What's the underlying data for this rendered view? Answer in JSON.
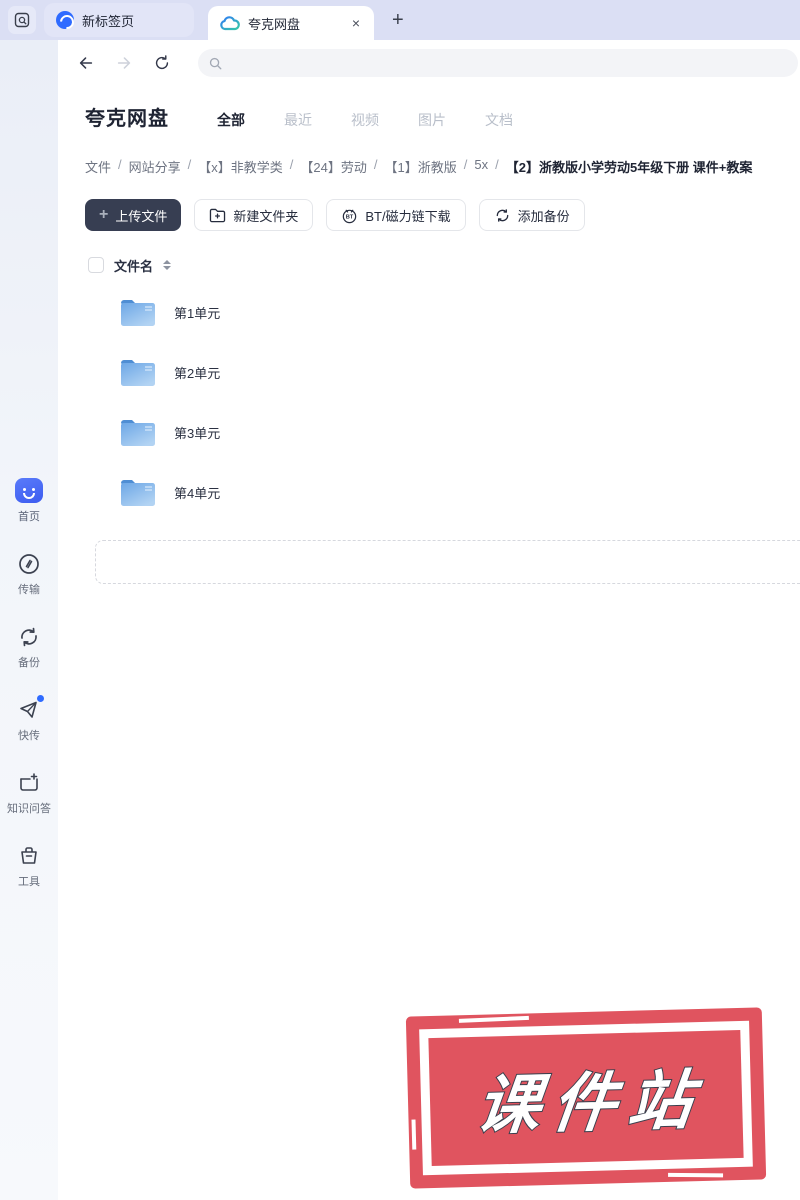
{
  "browser": {
    "tabs": [
      {
        "title": "新标签页",
        "active": false
      },
      {
        "title": "夸克网盘",
        "active": true
      }
    ],
    "close_glyph": "×",
    "new_tab_glyph": "+"
  },
  "nav": {
    "search_placeholder": ""
  },
  "header": {
    "app_title": "夸克网盘",
    "filter_tabs": [
      {
        "label": "全部",
        "active": true
      },
      {
        "label": "最近",
        "active": false
      },
      {
        "label": "视频",
        "active": false
      },
      {
        "label": "图片",
        "active": false
      },
      {
        "label": "文档",
        "active": false
      }
    ]
  },
  "breadcrumb": {
    "separator": "/",
    "items": [
      "文件",
      "网站分享",
      "【x】非教学类",
      "【24】劳动",
      "【1】浙教版",
      "5x",
      "【2】浙教版小学劳动5年级下册 课件+教案"
    ]
  },
  "toolbar": {
    "upload_label": "上传文件",
    "upload_plus": "+",
    "new_folder_label": "新建文件夹",
    "bt_download_label": "BT/磁力链下载",
    "bt_glyph": "BT",
    "add_backup_label": "添加备份"
  },
  "file_list": {
    "header_label": "文件名",
    "folders": [
      {
        "name": "第1单元"
      },
      {
        "name": "第2单元"
      },
      {
        "name": "第3单元"
      },
      {
        "name": "第4单元"
      }
    ]
  },
  "sidebar": {
    "items": [
      {
        "label": "首页",
        "active": true
      },
      {
        "label": "传输",
        "active": false
      },
      {
        "label": "备份",
        "active": false
      },
      {
        "label": "快传",
        "active": false,
        "badge": true
      },
      {
        "label": "知识问答",
        "active": false
      },
      {
        "label": "工具",
        "active": false
      }
    ]
  },
  "watermark": {
    "text": "课件站"
  },
  "colors": {
    "tabbar_bg": "#dbdff4",
    "accent_blue": "#2f6bff",
    "dark_button": "#373e52",
    "stamp_red": "#e0545f",
    "folder_blue_dark": "#5d9add",
    "folder_blue_light": "#b2d3f3",
    "text_dark": "#1f2433",
    "text_gray": "#6e7482"
  }
}
